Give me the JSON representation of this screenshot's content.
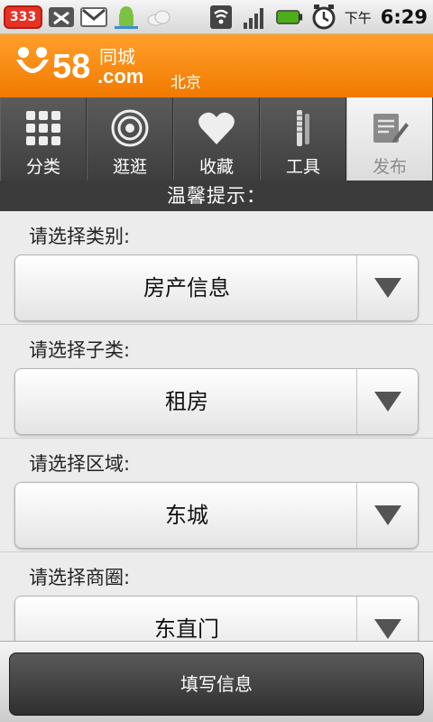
{
  "status_bar": {
    "notification_count": "333",
    "time": "6:29",
    "ampm": "下午"
  },
  "header": {
    "logo_text": "58同城",
    "logo_sub": ".com",
    "city": "北京",
    "brand_color": "#f58a14"
  },
  "tabs": [
    {
      "label": "分类",
      "icon": "grid-icon",
      "active": false
    },
    {
      "label": "逛逛",
      "icon": "target-icon",
      "active": false
    },
    {
      "label": "收藏",
      "icon": "heart-icon",
      "active": false
    },
    {
      "label": "工具",
      "icon": "tools-icon",
      "active": false
    },
    {
      "label": "发布",
      "icon": "edit-note-icon",
      "active": true
    }
  ],
  "notice": {
    "text": "温馨提示："
  },
  "form": {
    "fields": [
      {
        "label": "请选择类别:",
        "value": "房产信息"
      },
      {
        "label": "请选择子类:",
        "value": "租房"
      },
      {
        "label": "请选择区域:",
        "value": "东城"
      },
      {
        "label": "请选择商圈:",
        "value": "东直门"
      }
    ]
  },
  "bottom": {
    "submit_label": "填写信息"
  }
}
